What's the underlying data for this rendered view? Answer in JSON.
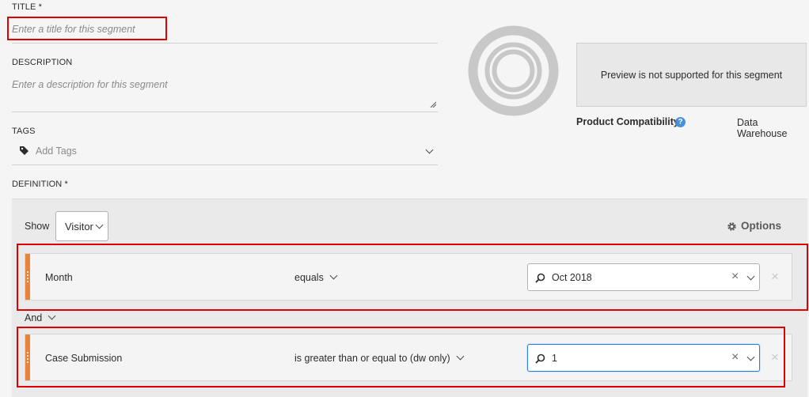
{
  "title": {
    "label": "TITLE *",
    "placeholder": "Enter a title for this segment"
  },
  "description": {
    "label": "DESCRIPTION",
    "placeholder": "Enter a description for this segment"
  },
  "tags": {
    "label": "TAGS",
    "placeholder": "Add Tags"
  },
  "definition": {
    "label": "DEFINITION *"
  },
  "preview": {
    "message": "Preview is not supported for this segment"
  },
  "compatibility": {
    "label": "Product Compatibility",
    "value": "Data Warehouse"
  },
  "toolbar": {
    "show_label": "Show",
    "show_value": "Visitor",
    "options_label": "Options"
  },
  "rules": [
    {
      "dimension": "Month",
      "operator": "equals",
      "value": "Oct 2018",
      "focused": false
    },
    {
      "dimension": "Case Submission",
      "operator": "is greater than or equal to (dw only)",
      "value": "1",
      "focused": true
    }
  ],
  "connector": {
    "label": "And"
  },
  "colors": {
    "accent_handle": "#e8833a",
    "highlight": "#e00000",
    "focus": "#2680eb",
    "help": "#4a8fd9"
  }
}
